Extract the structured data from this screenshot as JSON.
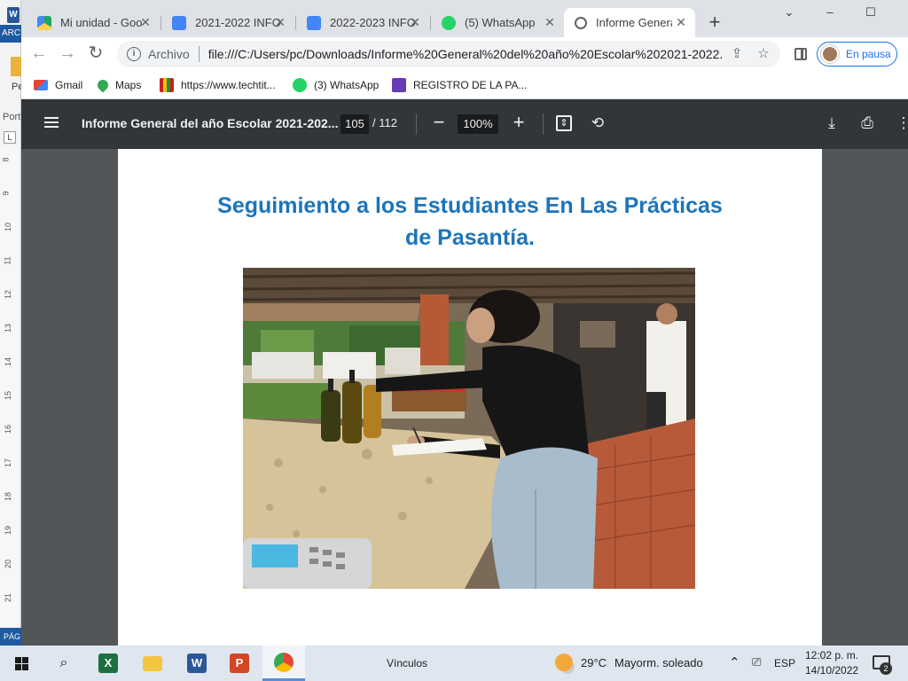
{
  "word_side": {
    "icon_letter": "W",
    "tab_label": "ARC",
    "folder_label": "Pe",
    "section_label": "Port",
    "ruler_tab": "L",
    "ruler_numbers": [
      "8",
      "9",
      "10",
      "11",
      "12",
      "13",
      "14",
      "15",
      "16",
      "17",
      "18",
      "19",
      "20",
      "21"
    ],
    "bottom_tab": "PÁG"
  },
  "tabs": [
    {
      "label": "Mi unidad - Goo",
      "icon": "google-drive-icon",
      "color": "#1fa463"
    },
    {
      "label": "2021-2022 INFO",
      "icon": "google-docs-icon",
      "color": "#4285f4"
    },
    {
      "label": "2022-2023 INFO",
      "icon": "google-docs-icon",
      "color": "#4285f4"
    },
    {
      "label": "(5) WhatsApp",
      "icon": "whatsapp-icon",
      "color": "#25d366"
    },
    {
      "label": "Informe General",
      "icon": "globe-icon",
      "color": "#5f6368"
    }
  ],
  "window": {
    "minimize": "⌄",
    "restore": "–",
    "maximize": "☐"
  },
  "omnibox": {
    "scheme_label": "Archivo",
    "url": "file:///C:/Users/pc/Downloads/Informe%20General%20del%20año%20Escolar%202021-2022..."
  },
  "profile": {
    "label": "En pausa"
  },
  "bookmarks": [
    {
      "label": "Gmail",
      "icon": "gmail-icon",
      "color": "#ea4335"
    },
    {
      "label": "Maps",
      "icon": "maps-icon",
      "color": "#34a853"
    },
    {
      "label": "https://www.techtit...",
      "icon": "grid-icon",
      "color": "#c5221f"
    },
    {
      "label": "(3) WhatsApp",
      "icon": "whatsapp-icon",
      "color": "#25d366"
    },
    {
      "label": "REGISTRO DE LA PA...",
      "icon": "forms-icon",
      "color": "#673ab7"
    }
  ],
  "pdf_toolbar": {
    "title": "Informe General del año Escolar 2021-202...",
    "page_current": "105",
    "page_total": "/ 112",
    "zoom": "100%"
  },
  "document": {
    "heading_line1": "Seguimiento a los Estudiantes En Las Prácticas",
    "heading_line2": "de Pasantía."
  },
  "taskbar": {
    "search_label": "Vínculos",
    "weather_temp": "29°C",
    "weather_desc": "Mayorm. soleado",
    "language": "ESP",
    "time": "12:02 p. m.",
    "date": "14/10/2022",
    "notification_count": "2",
    "apps": [
      {
        "name": "excel-icon",
        "letter": "X",
        "color": "#1d6f42"
      },
      {
        "name": "file-explorer-icon",
        "letter": "",
        "color": "#f4c542"
      },
      {
        "name": "word-icon",
        "letter": "W",
        "color": "#2b579a"
      },
      {
        "name": "powerpoint-icon",
        "letter": "P",
        "color": "#d24726"
      },
      {
        "name": "chrome-icon",
        "letter": "",
        "color": "#4285f4"
      }
    ]
  }
}
